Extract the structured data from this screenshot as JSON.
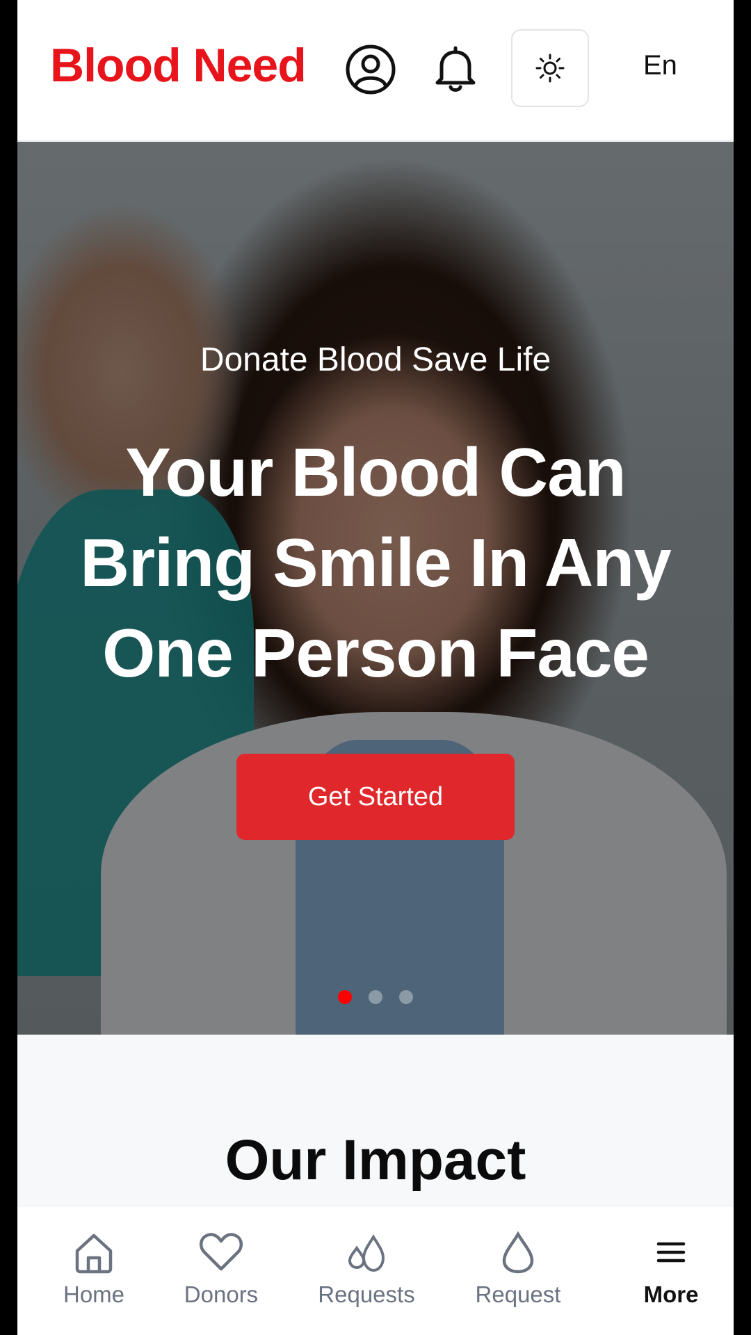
{
  "header": {
    "brand": "Blood Need",
    "language": "En",
    "icons": [
      "user-circle-icon",
      "bell-icon",
      "sun-icon"
    ]
  },
  "hero": {
    "subtitle": "Donate Blood Save Life",
    "title": "Your Blood Can Bring Smile In Any One Person Face",
    "cta_label": "Get Started",
    "slides_total": 3,
    "active_slide": 1
  },
  "impact": {
    "title": "Our Impact"
  },
  "bottom_nav": {
    "items": [
      {
        "label": "Home",
        "icon": "home-icon"
      },
      {
        "label": "Donors",
        "icon": "heart-icon"
      },
      {
        "label": "Requests",
        "icon": "drops-icon"
      },
      {
        "label": "Request",
        "icon": "drop-icon"
      },
      {
        "label": "More",
        "icon": "menu-icon"
      }
    ],
    "active": "More"
  },
  "colors": {
    "brand": "#e8141b",
    "cta": "#e0282c",
    "active_dot": "#ff0000"
  }
}
